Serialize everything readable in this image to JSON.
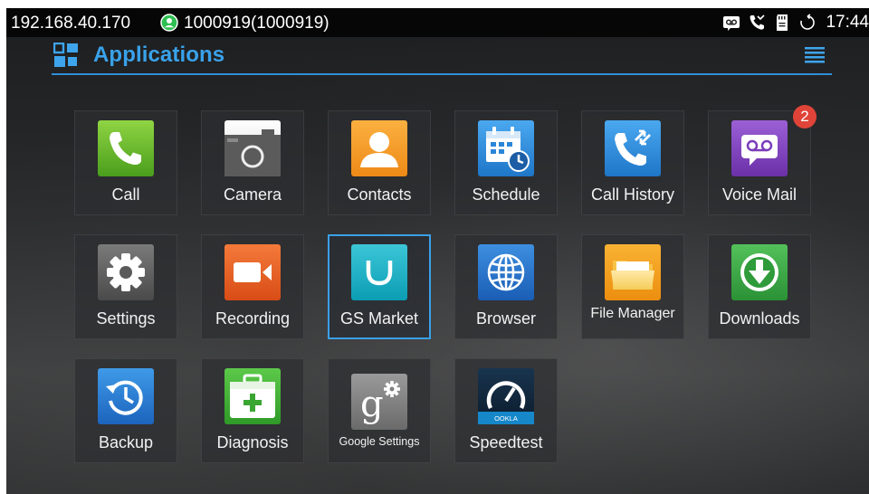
{
  "status_bar": {
    "ip": "192.168.40.170",
    "account": "1000919(1000919)",
    "time": "17:44",
    "icons": [
      "account-status-icon",
      "voicemail-icon",
      "missed-call-icon",
      "sd-card-icon",
      "sync-icon"
    ]
  },
  "header": {
    "title": "Applications",
    "title_color": "#39a2ea",
    "icons": [
      "apps-grid-icon",
      "menu-icon"
    ]
  },
  "apps": [
    {
      "label": "Call",
      "icon": "call-icon"
    },
    {
      "label": "Camera",
      "icon": "camera-icon"
    },
    {
      "label": "Contacts",
      "icon": "contacts-icon"
    },
    {
      "label": "Schedule",
      "icon": "schedule-icon"
    },
    {
      "label": "Call History",
      "icon": "call-history-icon"
    },
    {
      "label": "Voice Mail",
      "icon": "voice-mail-icon",
      "badge": "2"
    },
    {
      "label": "Settings",
      "icon": "settings-icon"
    },
    {
      "label": "Recording",
      "icon": "recording-icon"
    },
    {
      "label": "GS Market",
      "icon": "gs-market-icon",
      "selected": true
    },
    {
      "label": "Browser",
      "icon": "browser-icon"
    },
    {
      "label": "File  Manager",
      "icon": "file-manager-icon"
    },
    {
      "label": "Downloads",
      "icon": "downloads-icon"
    },
    {
      "label": "Backup",
      "icon": "backup-icon"
    },
    {
      "label": "Diagnosis",
      "icon": "diagnosis-icon"
    },
    {
      "label": "Google Settings",
      "icon": "google-settings-icon"
    },
    {
      "label": "Speedtest",
      "icon": "speedtest-icon",
      "icon_text": "OOKLA"
    }
  ],
  "colors": {
    "accent": "#39a2ea",
    "badge": "#e04438",
    "selected_border": "#3aa0e8"
  }
}
